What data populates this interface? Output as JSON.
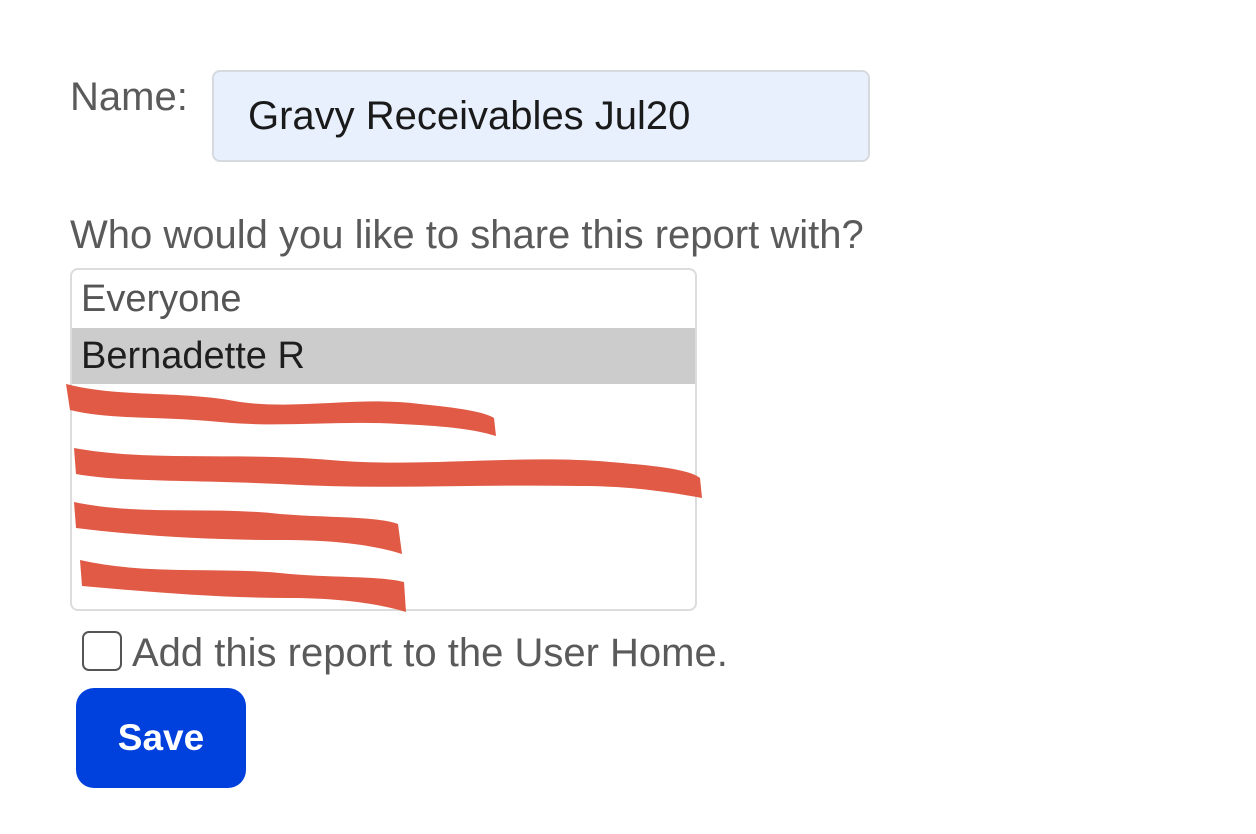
{
  "form": {
    "name_label": "Name:",
    "name_value": "Gravy Receivables Jul20",
    "share_question": "Who would you like to share this report with?",
    "share_options": [
      {
        "label": "Everyone",
        "selected": false,
        "redacted": false
      },
      {
        "label": "Bernadette R",
        "selected": true,
        "redacted": false
      },
      {
        "label": "",
        "selected": false,
        "redacted": true
      },
      {
        "label": "",
        "selected": false,
        "redacted": true
      },
      {
        "label": "",
        "selected": false,
        "redacted": true
      },
      {
        "label": "",
        "selected": false,
        "redacted": true
      }
    ],
    "add_home_label": "Add this report to the User Home.",
    "add_home_checked": false,
    "save_label": "Save"
  },
  "colors": {
    "accent": "#0040dd",
    "input_bg": "#e8f0fe",
    "selected_bg": "#cccccc",
    "redaction": "#e05a45"
  }
}
